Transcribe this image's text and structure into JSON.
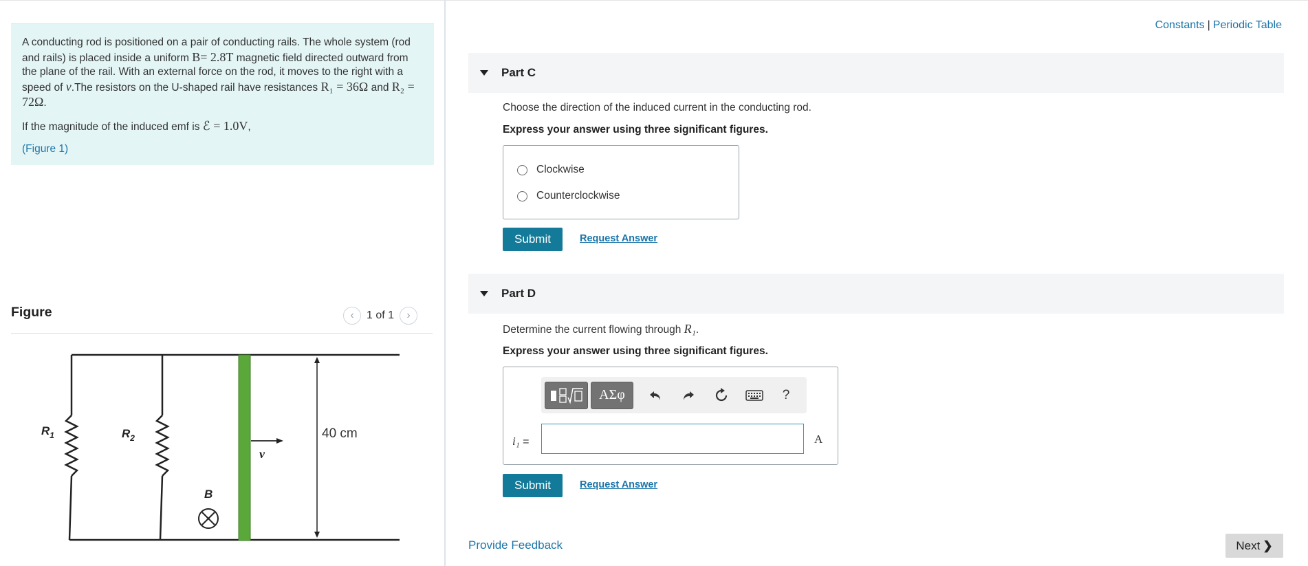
{
  "problem": {
    "line_part1": "A conducting rod is positioned on a pair of conducting rails. The whole system (rod and rails) is placed inside a uniform ",
    "B_expr": "B= 2.8T",
    "line_part2": " magnetic field directed outward from the plane of the rail. With an external force on the rod, it moves to the right with a speed of ",
    "v_symbol": "v",
    "line_part3": ".The resistors on the U-shaped rail have resistances ",
    "R1_expr": "R₁ = 36Ω",
    "and_text": " and ",
    "R2_expr": "R₂ = 72Ω",
    "end_period": ".",
    "emf_prefix": "If the magnitude of the induced emf is ",
    "emf_expr": "ℰ = 1.0V",
    "emf_suffix": ",",
    "figure_link": "(Figure 1)"
  },
  "figure": {
    "title": "Figure",
    "prev_icon": "chevron-left-icon",
    "next_icon": "chevron-right-icon",
    "count": "1 of 1",
    "labels": {
      "r1_main": "R",
      "r1_sub": "1",
      "r2_main": "R",
      "r2_sub": "2",
      "velocity": "v",
      "field": "B",
      "width": "40 cm"
    }
  },
  "top_links": {
    "constants": "Constants",
    "separator": "|",
    "periodic_table": "Periodic Table"
  },
  "part_c": {
    "title": "Part C",
    "question": "Choose the direction of the induced current in the conducting rod.",
    "instruction": "Express your answer using three significant figures.",
    "options": [
      "Clockwise",
      "Counterclockwise"
    ],
    "submit": "Submit",
    "request": "Request Answer"
  },
  "part_d": {
    "title": "Part D",
    "question_prefix": "Determine the current flowing through ",
    "question_var": "R₁",
    "question_suffix": ".",
    "instruction": "Express your answer using three significant figures.",
    "toolbar": {
      "templates_icon": "math-templates-icon",
      "greek_label": "ΑΣφ",
      "undo_icon": "undo-icon",
      "redo_icon": "redo-icon",
      "reset_icon": "reset-icon",
      "keyboard_icon": "keyboard-icon",
      "help_label": "?"
    },
    "variable": "i₁",
    "equals": "=",
    "input_value": "",
    "unit": "A",
    "submit": "Submit",
    "request": "Request Answer"
  },
  "footer": {
    "feedback": "Provide Feedback",
    "next": "Next",
    "next_icon": "chevron-right-icon"
  },
  "colors": {
    "accent": "#137b99",
    "link": "#1b75a8",
    "problem_bg": "#e4f5f6",
    "rod": "#5aa83a"
  }
}
